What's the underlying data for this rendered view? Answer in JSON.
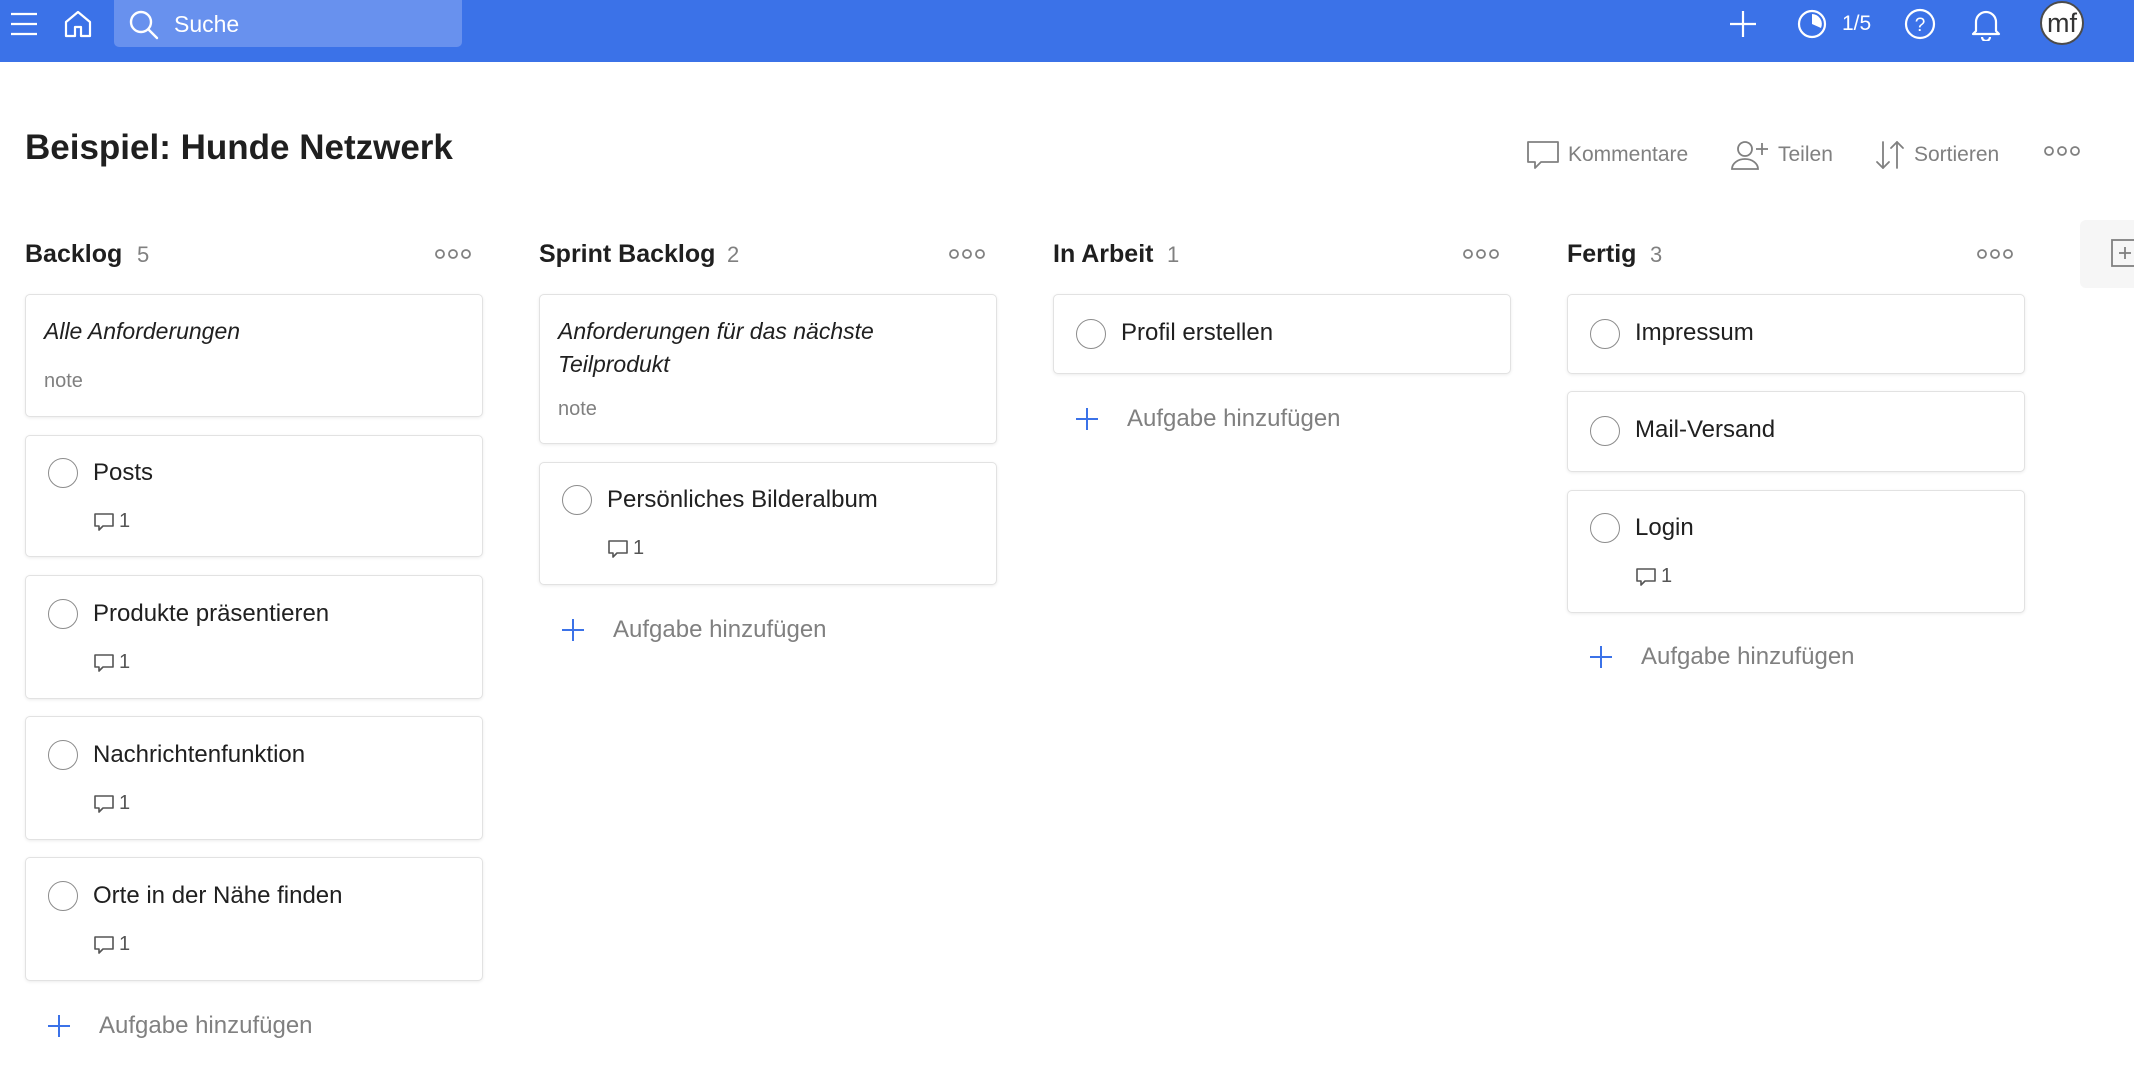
{
  "colors": {
    "topbar": "#3b72e8",
    "accent_plus": "#3b72e8",
    "text_muted": "#808080"
  },
  "topbar": {
    "search_placeholder": "Suche",
    "karma": "1/5",
    "avatar_initials": "mf",
    "icons": [
      "menu-icon",
      "home-icon",
      "search-icon",
      "plus-icon",
      "productivity-icon",
      "help-icon",
      "bell-icon"
    ]
  },
  "project": {
    "title": "Beispiel: Hunde Netzwerk"
  },
  "actions": {
    "comments": "Kommentare",
    "share": "Teilen",
    "sort": "Sortieren"
  },
  "add_task_label": "Aufgabe hinzufügen",
  "columns": [
    {
      "title": "Backlog",
      "count": "5",
      "note": {
        "title": "Alle Anforderungen",
        "sub": "note"
      },
      "tasks": [
        {
          "title": "Posts",
          "comments": "1"
        },
        {
          "title": "Produkte präsentieren",
          "comments": "1"
        },
        {
          "title": "Nachrichtenfunktion",
          "comments": "1"
        },
        {
          "title": "Orte in der Nähe finden",
          "comments": "1"
        }
      ]
    },
    {
      "title": "Sprint Backlog",
      "count": "2",
      "note": {
        "title": "Anforderungen für das nächste Teilprodukt",
        "sub": "note"
      },
      "tasks": [
        {
          "title": "Persönliches Bilderalbum",
          "comments": "1"
        }
      ]
    },
    {
      "title": "In Arbeit",
      "count": "1",
      "tasks": [
        {
          "title": "Profil erstellen"
        }
      ]
    },
    {
      "title": "Fertig",
      "count": "3",
      "tasks": [
        {
          "title": "Impressum"
        },
        {
          "title": "Mail-Versand"
        },
        {
          "title": "Login",
          "comments": "1"
        }
      ]
    }
  ]
}
